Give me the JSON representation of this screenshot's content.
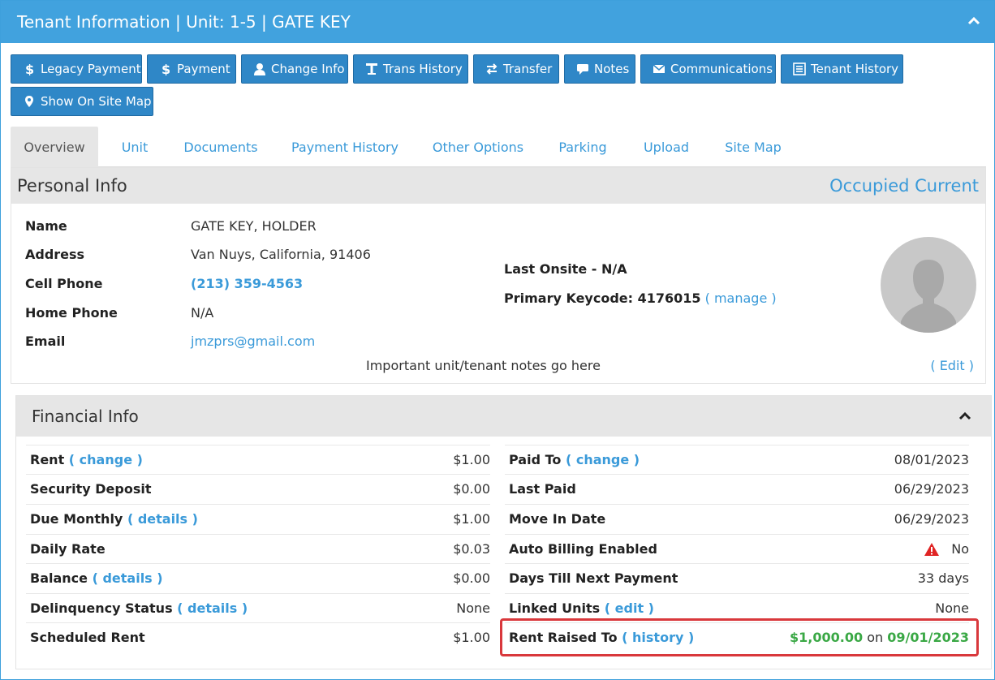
{
  "header": {
    "title": "Tenant Information | Unit: 1-5 | GATE KEY"
  },
  "actions": {
    "legacy_payment": "Legacy Payment",
    "payment": "Payment",
    "change_info": "Change Info",
    "trans_history": "Trans History",
    "transfer": "Transfer",
    "notes": "Notes",
    "communications": "Communications",
    "tenant_history": "Tenant History",
    "show_on_site_map": "Show On Site Map"
  },
  "tabs": [
    "Overview",
    "Unit",
    "Documents",
    "Payment History",
    "Other Options",
    "Parking",
    "Upload",
    "Site Map"
  ],
  "personal": {
    "title": "Personal Info",
    "status": "Occupied Current",
    "name_label": "Name",
    "name": "GATE KEY, HOLDER",
    "address_label": "Address",
    "address": "Van Nuys, California, 91406",
    "cell_label": "Cell Phone",
    "cell": "(213) 359-4563",
    "home_label": "Home Phone",
    "home": "N/A",
    "email_label": "Email",
    "email": "jmzprs@gmail.com",
    "last_onsite": "Last Onsite - N/A",
    "keycode_label": "Primary Keycode: 4176015",
    "manage": "( manage )",
    "notes": "Important unit/tenant notes go here",
    "edit": "( Edit )"
  },
  "financial": {
    "title": "Financial Info",
    "left": [
      {
        "label": "Rent",
        "link": "( change )",
        "value": "$1.00"
      },
      {
        "label": "Security Deposit",
        "link": "",
        "value": "$0.00"
      },
      {
        "label": "Due Monthly",
        "link": "( details )",
        "value": "$1.00"
      },
      {
        "label": "Daily Rate",
        "link": "",
        "value": "$0.03"
      },
      {
        "label": "Balance",
        "link": "( details )",
        "value": "$0.00"
      },
      {
        "label": "Delinquency Status",
        "link": "( details )",
        "value": "None"
      },
      {
        "label": "Scheduled Rent",
        "link": "",
        "value": "$1.00"
      }
    ],
    "right": [
      {
        "label": "Paid To",
        "link": "( change )",
        "value": "08/01/2023"
      },
      {
        "label": "Last Paid",
        "link": "",
        "value": "06/29/2023"
      },
      {
        "label": "Move In Date",
        "link": "",
        "value": "06/29/2023"
      },
      {
        "label": "Auto Billing Enabled",
        "link": "",
        "value": "No"
      },
      {
        "label": "Days Till Next Payment",
        "link": "",
        "value": "33 days"
      },
      {
        "label": "Linked Units",
        "link": "( edit )",
        "value": "None"
      },
      {
        "label": "Rent Raised To",
        "link": "( history )",
        "value": "$1,000.00",
        "on": "on",
        "date": "09/01/2023"
      }
    ]
  },
  "colors": {
    "header_bg": "#41a2de",
    "button_bg": "#2f87c7",
    "link": "#3a9ad9",
    "green": "#3aa845",
    "highlight": "#d9383c"
  }
}
